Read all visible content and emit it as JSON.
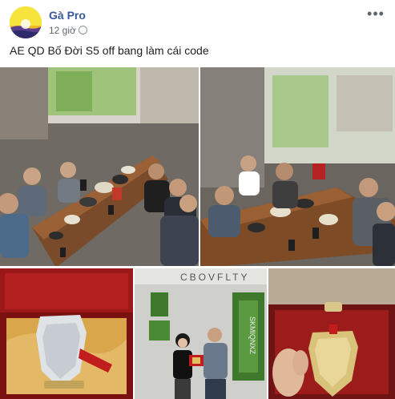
{
  "author": {
    "name": "Gà Pro",
    "avatar_icon": "sunset-landscape-avatar"
  },
  "post": {
    "timestamp": "12 giờ",
    "privacy_icon": "globe-icon",
    "more_icon": "more-options-icon",
    "text": "AE QD Bố Đời S5 off bang làm cái code"
  },
  "photos": [
    {
      "subject": "group-dinner-wide"
    },
    {
      "subject": "group-dinner-second-angle"
    },
    {
      "subject": "trophy-in-red-box"
    },
    {
      "subject": "award-presentation",
      "wall_letters": "CBOVFLTY",
      "wall_letters_side": "SKMIQNXZ"
    },
    {
      "subject": "trophy-held-in-hand"
    }
  ],
  "colors": {
    "link_blue": "#385898",
    "text": "#1c1e21",
    "meta_gray": "#606770",
    "box_red": "#8c1414",
    "silk_gold": "#d9a64b",
    "plant_green": "#3f7a2c"
  }
}
